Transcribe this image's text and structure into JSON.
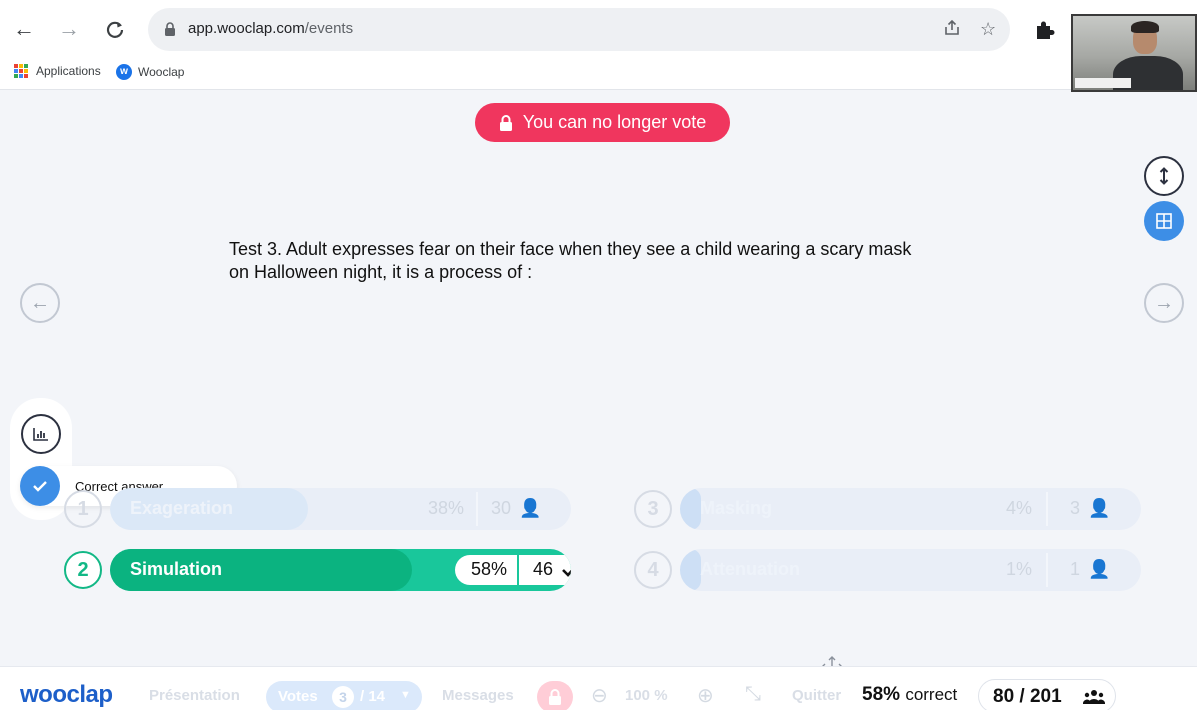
{
  "browser": {
    "url_host": "app.wooclap.com",
    "url_path": "/events",
    "bookmarks": [
      {
        "label": "Applications",
        "icon": "apps-grid-icon"
      },
      {
        "label": "Wooclap",
        "icon": "wooclap-logo-icon"
      }
    ]
  },
  "banner": {
    "text": "You can no longer vote",
    "color": "#f0365e"
  },
  "question": {
    "text": "Test 3. Adult expresses fear on their face when they see a child wearing a scary mask on Halloween night, it is a process of :"
  },
  "overlay": {
    "correct_answer_label": "Correct answer"
  },
  "answers": [
    {
      "num": "1",
      "label": "Exageration",
      "percent": "38%",
      "count": "30",
      "fraction": 0.38,
      "correct": false
    },
    {
      "num": "2",
      "label": "Simulation",
      "percent": "58%",
      "count": "46",
      "fraction": 0.58,
      "correct": true
    },
    {
      "num": "3",
      "label": "Masking",
      "percent": "4%",
      "count": "3",
      "fraction": 0.04,
      "correct": false
    },
    {
      "num": "4",
      "label": "Attenuation",
      "percent": "1%",
      "count": "1",
      "fraction": 0.01,
      "correct": false
    }
  ],
  "toolbar": {
    "logo": "wooclap",
    "presentation": "Présentation",
    "votes_label": "Votes",
    "votes_current": "3",
    "votes_total": "/ 14",
    "messages": "Messages",
    "zoom": "100 %",
    "quit": "Quitter",
    "correct_percent": "58%",
    "correct_word": "correct",
    "participation": "80 / 201"
  },
  "colors": {
    "correct_green": "#19c79b",
    "accent_blue": "#3d8ee6",
    "logo_blue": "#1d5fc9"
  }
}
